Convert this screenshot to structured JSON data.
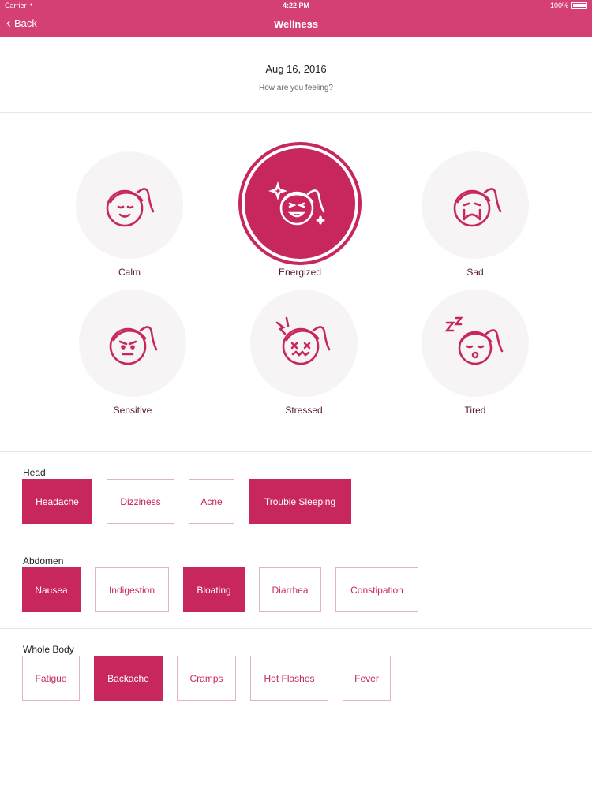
{
  "status_bar": {
    "carrier": "Carrier",
    "time": "4:22 PM",
    "battery": "100%"
  },
  "nav": {
    "back_label": "Back",
    "title": "Wellness"
  },
  "header": {
    "date": "Aug 16, 2016",
    "prompt": "How are you feeling?"
  },
  "moods": [
    {
      "label": "Calm",
      "icon": "calm-face-icon",
      "selected": false
    },
    {
      "label": "Energized",
      "icon": "energized-face-icon",
      "selected": true
    },
    {
      "label": "Sad",
      "icon": "sad-face-icon",
      "selected": false
    },
    {
      "label": "Sensitive",
      "icon": "sensitive-face-icon",
      "selected": false
    },
    {
      "label": "Stressed",
      "icon": "stressed-face-icon",
      "selected": false
    },
    {
      "label": "Tired",
      "icon": "tired-face-icon",
      "selected": false
    }
  ],
  "sections": [
    {
      "title": "Head",
      "chips": [
        {
          "label": "Headache",
          "selected": true
        },
        {
          "label": "Dizziness",
          "selected": false
        },
        {
          "label": "Acne",
          "selected": false
        },
        {
          "label": "Trouble Sleeping",
          "selected": true
        }
      ]
    },
    {
      "title": "Abdomen",
      "chips": [
        {
          "label": "Nausea",
          "selected": true
        },
        {
          "label": "Indigestion",
          "selected": false
        },
        {
          "label": "Bloating",
          "selected": true
        },
        {
          "label": "Diarrhea",
          "selected": false
        },
        {
          "label": "Constipation",
          "selected": false
        }
      ]
    },
    {
      "title": "Whole Body",
      "chips": [
        {
          "label": "Fatigue",
          "selected": false
        },
        {
          "label": "Backache",
          "selected": true
        },
        {
          "label": "Cramps",
          "selected": false
        },
        {
          "label": "Hot Flashes",
          "selected": false
        },
        {
          "label": "Fever",
          "selected": false
        }
      ]
    }
  ],
  "colors": {
    "accent": "#c8275d",
    "nav": "#d43f74",
    "chip_border": "#e2b3c4",
    "mood_bg": "#f6f4f4"
  }
}
